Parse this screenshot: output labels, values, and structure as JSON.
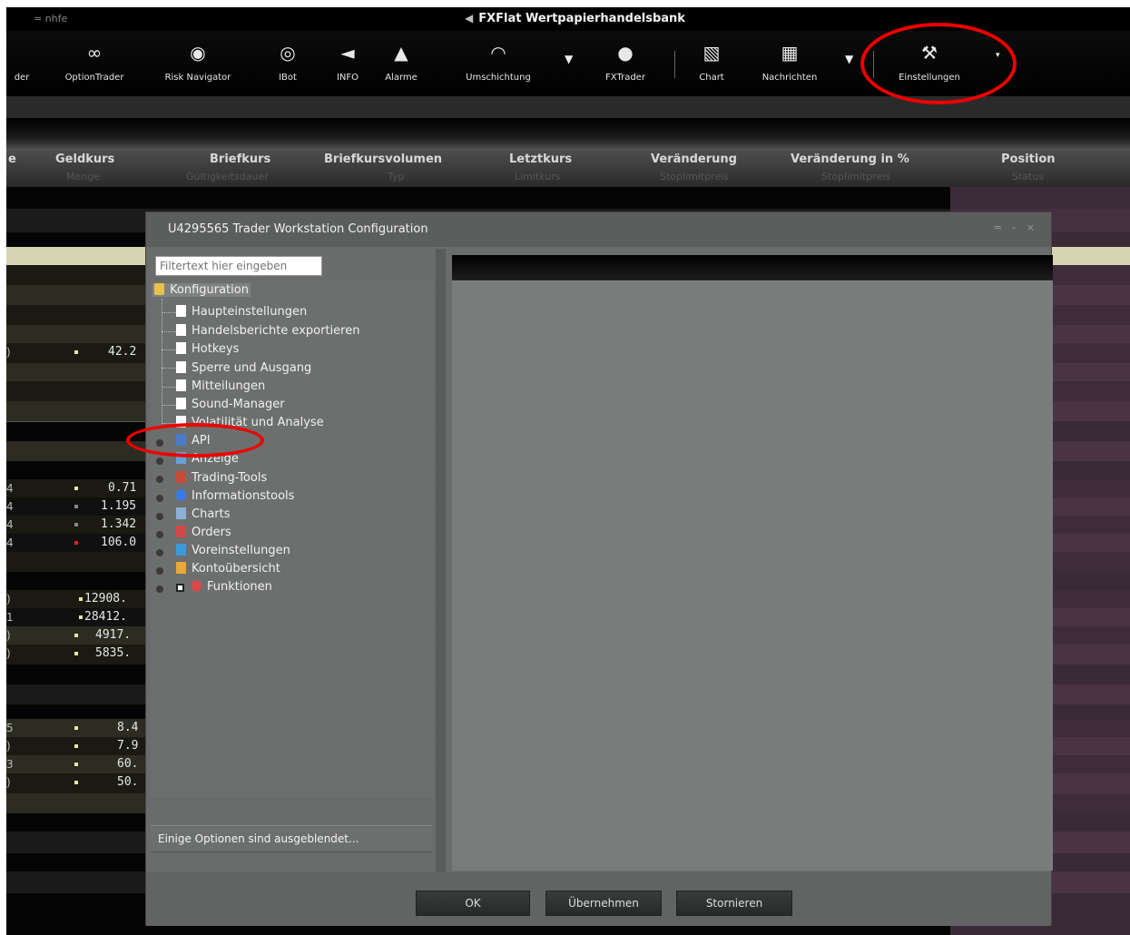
{
  "titlebar": {
    "left_text": "= nhfe",
    "title": "FXFlat Wertpapierhandelsbank"
  },
  "toolbar": {
    "items": [
      {
        "label": "der",
        "icon": "tool-icon"
      },
      {
        "label": "OptionTrader",
        "icon": "link-icon"
      },
      {
        "label": "Risk Navigator",
        "icon": "compass-icon"
      },
      {
        "label": "IBot",
        "icon": "robot-icon"
      },
      {
        "label": "INFO",
        "icon": "megaphone-icon"
      },
      {
        "label": "Alarme",
        "icon": "bell-icon"
      },
      {
        "label": "Umschichtung",
        "icon": "gauge-icon"
      },
      {
        "label": "FXTrader",
        "icon": "globe-icon"
      },
      {
        "label": "Chart",
        "icon": "chart-icon"
      },
      {
        "label": "Nachrichten",
        "icon": "rss-icon"
      },
      {
        "label": "Einstellungen",
        "icon": "wrench-icon"
      }
    ]
  },
  "columns": [
    {
      "label": "e",
      "sub": ""
    },
    {
      "label": "Geldkurs",
      "sub": "Menge"
    },
    {
      "label": "Briefkurs",
      "sub": "Gültigkeitsdauer"
    },
    {
      "label": "Briefkursvolumen",
      "sub": "Typ"
    },
    {
      "label": "Letztkurs",
      "sub": "Limitkurs"
    },
    {
      "label": "Veränderung",
      "sub": "Stoplimitpreis"
    },
    {
      "label": "Veränderung in %",
      "sub": "Stoplimitpreis"
    },
    {
      "label": "Position",
      "sub": "Status"
    }
  ],
  "rows": [
    {
      "lead": ")",
      "value": "42.2",
      "dot": "yellow"
    },
    {
      "lead": "4",
      "value": "0.71",
      "dot": "yellow"
    },
    {
      "lead": "4",
      "value": "1.195",
      "dot": "gray"
    },
    {
      "lead": "4",
      "value": "1.342",
      "dot": "gray"
    },
    {
      "lead": "4",
      "value": "106.0",
      "dot": "red"
    },
    {
      "lead": ")",
      "value": "12908.",
      "dot": "yellow"
    },
    {
      "lead": "1",
      "value": "28412.",
      "dot": "yellow"
    },
    {
      "lead": ")",
      "value": "4917.",
      "dot": "yellow"
    },
    {
      "lead": ")",
      "value": "5835.",
      "dot": "yellow"
    },
    {
      "lead": "5",
      "value": "8.4",
      "dot": "yellow"
    },
    {
      "lead": ")",
      "value": "7.9",
      "dot": "yellow"
    },
    {
      "lead": "3",
      "value": "60.",
      "dot": "yellow"
    },
    {
      "lead": ")",
      "value": "50.",
      "dot": "yellow"
    }
  ],
  "dialog": {
    "title": "U4295565 Trader Workstation Configuration",
    "controls": "= - ×",
    "filter_placeholder": "Filtertext hier eingeben",
    "tree": {
      "root": "Konfiguration",
      "children": [
        "Haupteinstellungen",
        "Handelsberichte exportieren",
        "Hotkeys",
        "Sperre und Ausgang",
        "Mitteilungen",
        "Sound-Manager",
        "Volatilität und Analyse"
      ],
      "groups": [
        "API",
        "Anzeige",
        "Trading-Tools",
        "Informationstools",
        "Charts",
        "Orders",
        "Voreinstellungen",
        "Kontoübersicht",
        "Funktionen"
      ]
    },
    "hidden_note": "Einige Optionen sind ausgeblendet...",
    "buttons": {
      "ok": "OK",
      "apply": "Übernehmen",
      "cancel": "Stornieren"
    }
  },
  "colors": {
    "annotation": "#ee0000",
    "purple_panel": "#3a2a35",
    "dialog_bg": "#6a6c6c"
  }
}
